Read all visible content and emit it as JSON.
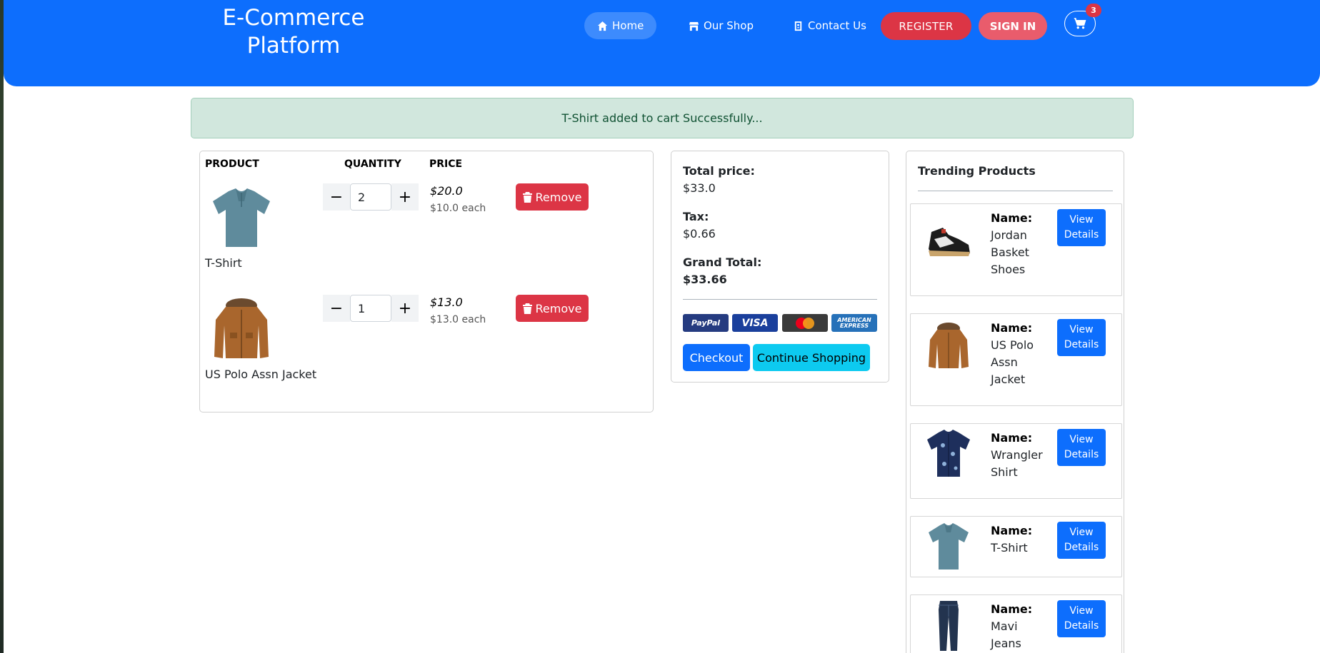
{
  "header": {
    "brand_line1": "E-Commerce",
    "brand_line2": "Platform",
    "nav": {
      "home": "Home",
      "shop": "Our Shop",
      "contact": "Contact Us"
    },
    "register_label": "REGISTER",
    "signin_label": "SIGN IN",
    "cart_count": "3"
  },
  "alert": {
    "message": "T-Shirt added to cart Successfully..."
  },
  "cart": {
    "columns": {
      "product": "PRODUCT",
      "quantity": "QUANTITY",
      "price": "PRICE"
    },
    "items": [
      {
        "name": "T-Shirt",
        "quantity": "2",
        "total": "$20.0",
        "each": "$10.0 each",
        "remove_label": "Remove"
      },
      {
        "name": "US Polo Assn Jacket",
        "quantity": "1",
        "total": "$13.0",
        "each": "$13.0 each",
        "remove_label": "Remove"
      }
    ]
  },
  "summary": {
    "total_label": "Total price:",
    "total_value": "$33.0",
    "tax_label": "Tax:",
    "tax_value": "$0.66",
    "grand_label": "Grand Total:",
    "grand_value": "$33.66",
    "payment_methods": [
      "PayPal",
      "VISA",
      "AMERICAN EXPRESS"
    ],
    "checkout_label": "Checkout",
    "continue_label": "Continue Shopping"
  },
  "trending": {
    "title": "Trending Products",
    "name_label": "Name:",
    "view_label": "View Details",
    "items": [
      {
        "name": "Jordan Basket Shoes"
      },
      {
        "name": "US Polo Assn Jacket"
      },
      {
        "name": "Wrangler Shirt"
      },
      {
        "name": "T-Shirt"
      },
      {
        "name": "Mavi Jeans"
      }
    ]
  },
  "colors": {
    "primary": "#0d6efd",
    "danger": "#dc3545",
    "info": "#0dcaf0",
    "success_bg": "#d1e7dd",
    "success_text": "#0f5132"
  }
}
